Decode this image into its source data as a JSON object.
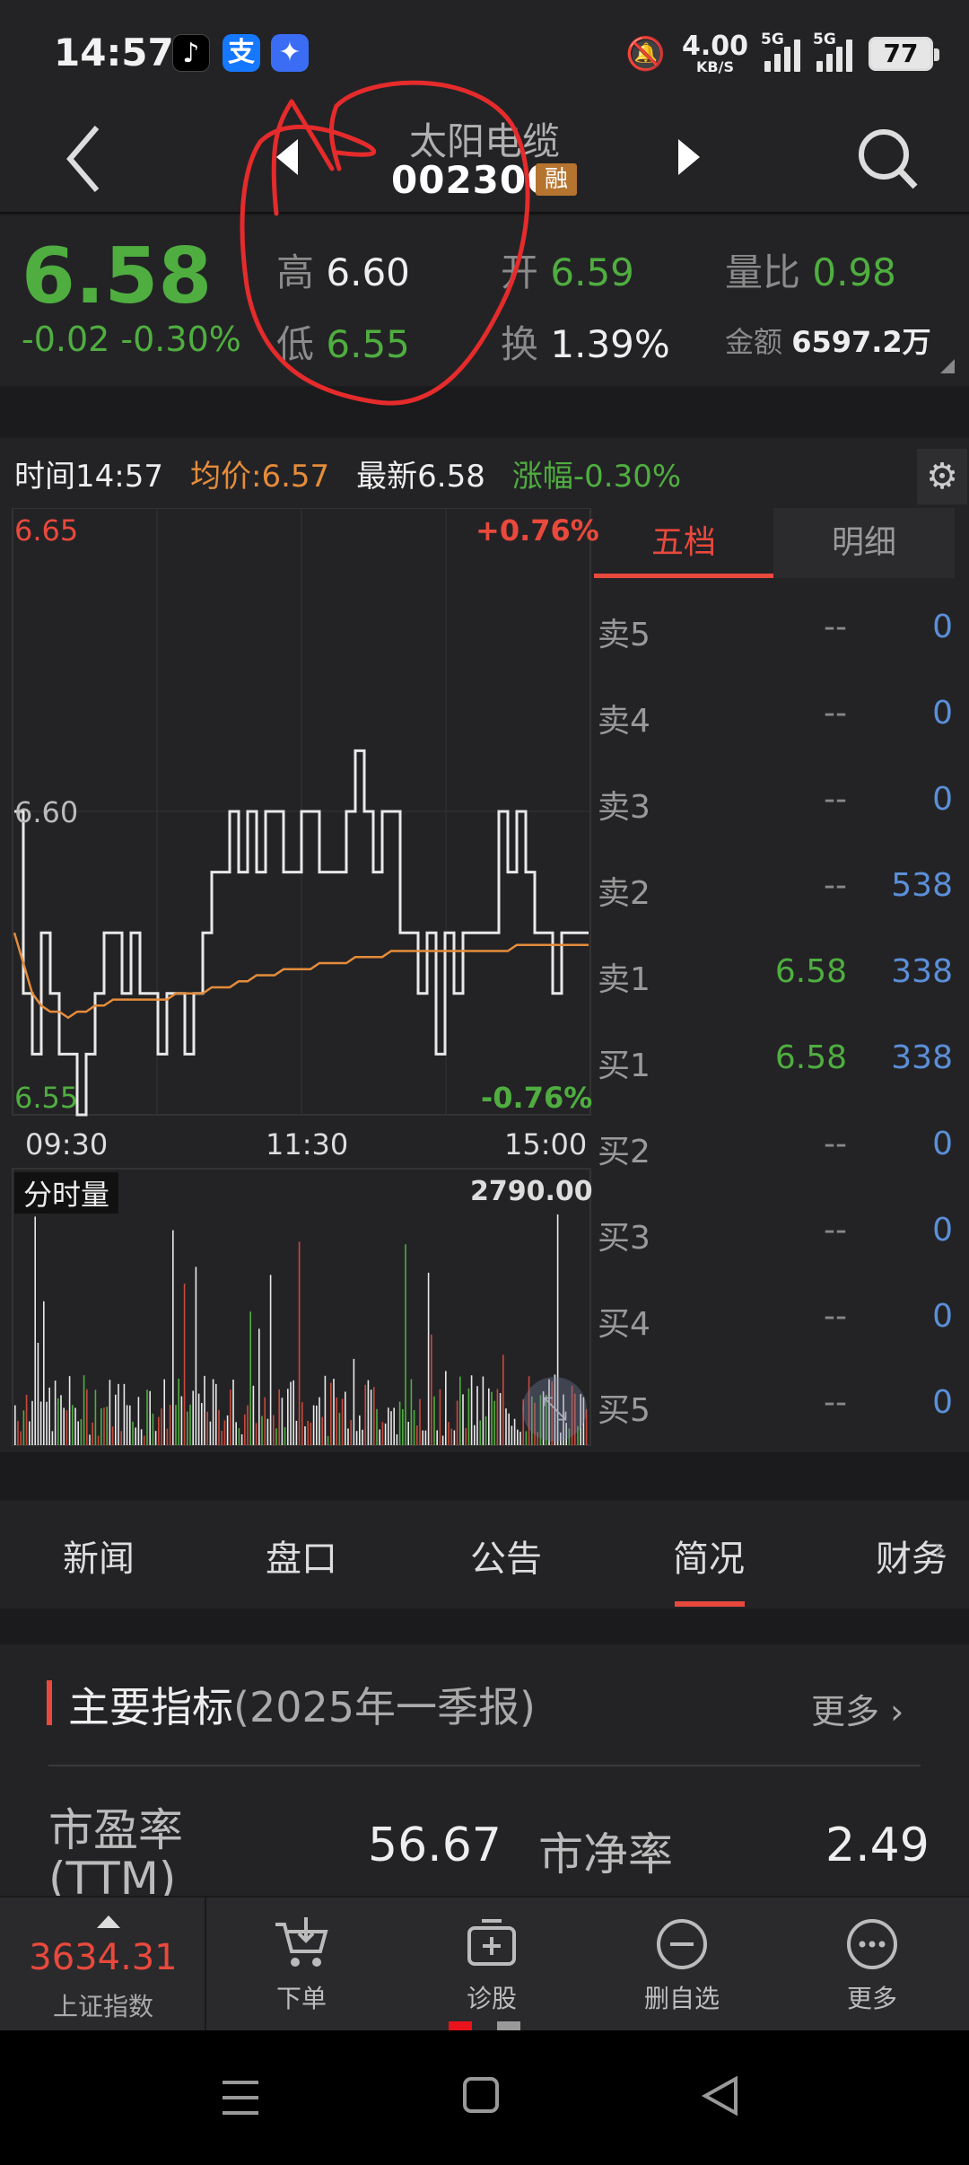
{
  "status_bar": {
    "time": "14:57",
    "speed": "4.00",
    "speed_unit": "KB/S",
    "net1": "5G",
    "net2": "5G",
    "battery": "77"
  },
  "header": {
    "title": "太阳电缆",
    "code": "002300",
    "badge": "融"
  },
  "quote": {
    "price": "6.58",
    "change": "-0.02",
    "change_pct": "-0.30%",
    "high_label": "高",
    "high": "6.60",
    "low_label": "低",
    "low": "6.55",
    "open_label": "开",
    "open": "6.59",
    "turnover_label": "换",
    "turnover": "1.39%",
    "ratio_label": "量比",
    "ratio": "0.98",
    "amount_label": "金额",
    "amount": "6597.2万"
  },
  "chart_bar": {
    "time": "时间14:57",
    "avg": "均价:6.57",
    "latest": "最新6.58",
    "change": "涨幅-0.30%"
  },
  "chart_labels": {
    "ymax": "6.65",
    "ymid": "6.60",
    "ymin": "6.55",
    "pct_max": "+0.76%",
    "pct_min": "-0.76%",
    "t1": "09:30",
    "t2": "11:30",
    "t3": "15:00",
    "vol_label": "分时量",
    "vol_max": "2790.00"
  },
  "chart_data": {
    "type": "line",
    "title": "",
    "xlabel": "",
    "ylabel": "",
    "ylim": [
      6.55,
      6.65
    ],
    "series": [
      {
        "values": [
          6.6,
          6.57,
          6.56,
          6.58,
          6.57,
          6.56,
          6.56,
          6.55,
          6.56,
          6.57,
          6.58,
          6.58,
          6.57,
          6.58,
          6.57,
          6.57,
          6.56,
          6.57,
          6.57,
          6.56,
          6.57,
          6.58,
          6.59,
          6.59,
          6.6,
          6.59,
          6.6,
          6.59,
          6.6,
          6.6,
          6.59,
          6.59,
          6.6,
          6.6,
          6.59,
          6.59,
          6.59,
          6.6,
          6.61,
          6.6,
          6.59,
          6.6,
          6.6,
          6.58,
          6.58,
          6.57,
          6.58,
          6.56,
          6.58,
          6.57,
          6.58,
          6.58,
          6.58,
          6.58,
          6.6,
          6.59,
          6.6,
          6.59,
          6.58,
          6.58,
          6.57,
          6.58,
          6.58,
          6.58,
          6.58
        ]
      },
      {
        "values": [
          6.58,
          6.575,
          6.57,
          6.568,
          6.567,
          6.567,
          6.566,
          6.567,
          6.567,
          6.568,
          6.568,
          6.569,
          6.569,
          6.569,
          6.569,
          6.569,
          6.569,
          6.569,
          6.57,
          6.57,
          6.57,
          6.57,
          6.571,
          6.571,
          6.571,
          6.572,
          6.572,
          6.573,
          6.573,
          6.573,
          6.574,
          6.574,
          6.574,
          6.574,
          6.575,
          6.575,
          6.575,
          6.575,
          6.576,
          6.576,
          6.576,
          6.576,
          6.577,
          6.577,
          6.577,
          6.577,
          6.577,
          6.577,
          6.577,
          6.577,
          6.577,
          6.577,
          6.577,
          6.577,
          6.577,
          6.577,
          6.578,
          6.578,
          6.578,
          6.578,
          6.578,
          6.578,
          6.578,
          6.578,
          6.578
        ]
      }
    ]
  },
  "orderbook": {
    "tabs": [
      "五档",
      "明细"
    ],
    "rows": [
      {
        "label": "卖5",
        "price": "--",
        "vol": "0"
      },
      {
        "label": "卖4",
        "price": "--",
        "vol": "0"
      },
      {
        "label": "卖3",
        "price": "--",
        "vol": "0"
      },
      {
        "label": "卖2",
        "price": "--",
        "vol": "538"
      },
      {
        "label": "卖1",
        "price": "6.58",
        "vol": "338"
      },
      {
        "label": "买1",
        "price": "6.58",
        "vol": "338"
      },
      {
        "label": "买2",
        "price": "--",
        "vol": "0"
      },
      {
        "label": "买3",
        "price": "--",
        "vol": "0"
      },
      {
        "label": "买4",
        "price": "--",
        "vol": "0"
      },
      {
        "label": "买5",
        "price": "--",
        "vol": "0"
      }
    ]
  },
  "tabs": [
    "新闻",
    "盘口",
    "公告",
    "简况",
    "财务"
  ],
  "indicators": {
    "title": "主要指标",
    "period": "(2025年一季报)",
    "more": "更多",
    "pe_label": "市盈率(TTM)",
    "pe": "56.67",
    "pb_label": "市净率",
    "pb": "2.49"
  },
  "bottom_nav": {
    "index_value": "3634.31",
    "index_name": "上证指数",
    "items": [
      "下单",
      "诊股",
      "删自选",
      "更多"
    ]
  }
}
